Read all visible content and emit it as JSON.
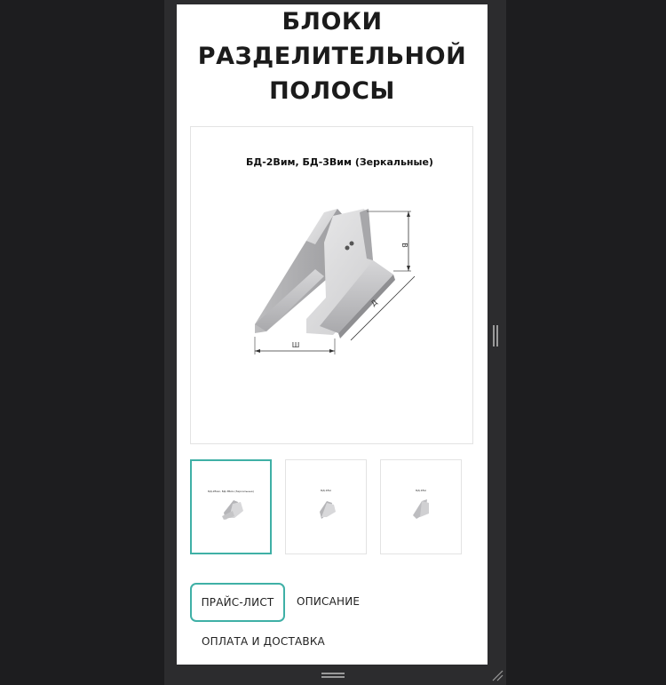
{
  "page": {
    "title_lines": [
      "БЛОКИ",
      "РАЗДЕЛИТЕЛЬНОЙ",
      "ПОЛОСЫ"
    ]
  },
  "gallery": {
    "main_caption": "БД-2Вим, БД-3Вим (Зеркальные)",
    "dimension_labels": {
      "height": "В",
      "length": "Д",
      "width": "Ш"
    },
    "thumbnails": [
      {
        "name": "thumb-1",
        "caption": "БД-2Вим, БД-3Вим (Зеркальные)",
        "active": true
      },
      {
        "name": "thumb-2",
        "caption": "БД-1Вм",
        "active": false
      },
      {
        "name": "thumb-3",
        "caption": "БД-1Вм",
        "active": false
      }
    ]
  },
  "tabs": {
    "price": "ПРАЙС-ЛИСТ",
    "description": "ОПИСАНИЕ",
    "payment": "ОПЛАТА И ДОСТАВКА"
  },
  "colors": {
    "accent": "#3fb0a6",
    "background": "#1d1d1f",
    "panel": "#ffffff",
    "text": "#1b1b1b"
  }
}
